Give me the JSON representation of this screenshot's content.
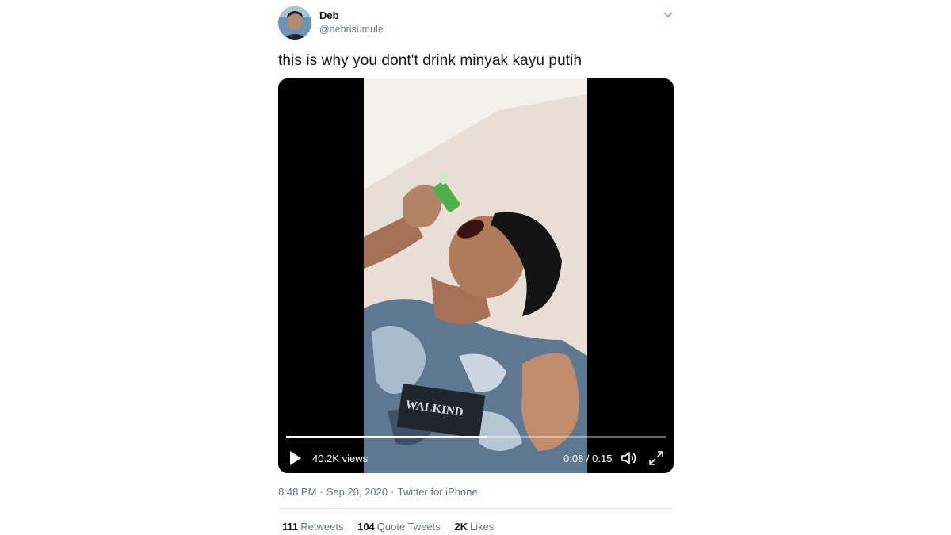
{
  "author": {
    "name": "Deb",
    "handle": "@debrisumule"
  },
  "tweet": {
    "text": "this is why you dont't drink minyak kayu putih"
  },
  "video": {
    "views": "40.2K views",
    "current_time": "0:08",
    "duration": "0:15",
    "progress": 0.53,
    "shirt_text": "WALKIND"
  },
  "meta": {
    "time": "8:48 PM",
    "date": "Sep 20, 2020",
    "source": "Twitter for iPhone"
  },
  "stats": {
    "retweets_count": "111",
    "retweets_label": "Retweets",
    "quotes_count": "104",
    "quotes_label": "Quote Tweets",
    "likes_count": "2K",
    "likes_label": "Likes"
  },
  "icons": {
    "caret": "chevron-down-icon",
    "play": "play-icon",
    "volume": "volume-icon",
    "fullscreen": "fullscreen-icon"
  }
}
